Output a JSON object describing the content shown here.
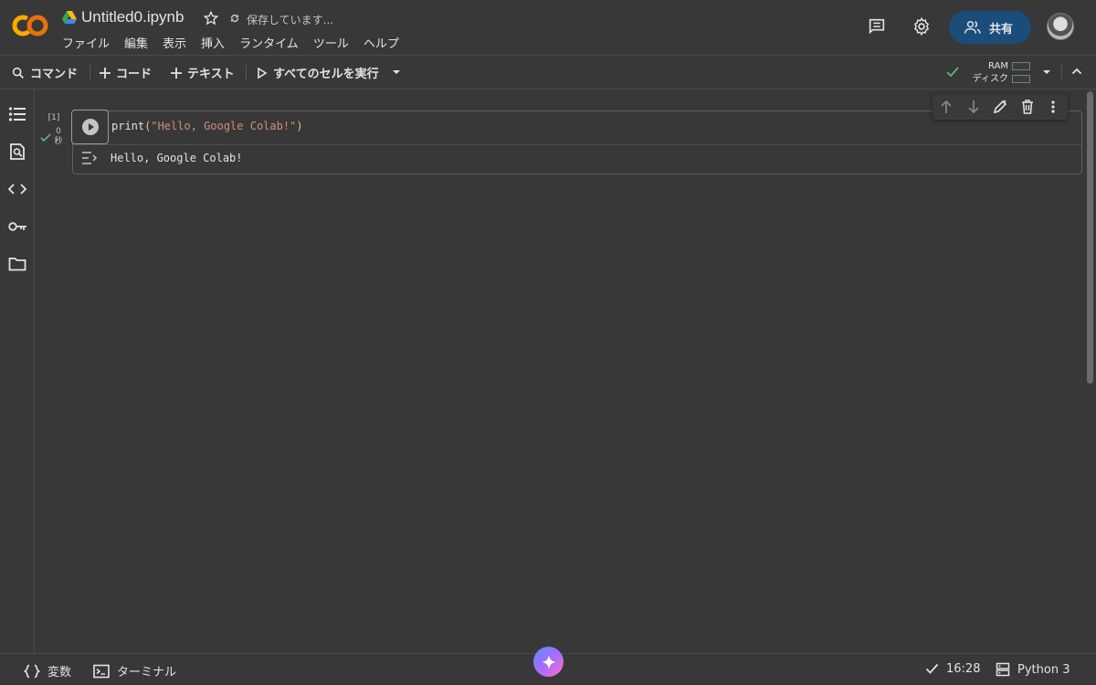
{
  "header": {
    "logo_text": "CO",
    "title": "Untitled0.ipynb",
    "saving_status": "保存しています...",
    "share_label": "共有",
    "menu": [
      "ファイル",
      "編集",
      "表示",
      "挿入",
      "ランタイム",
      "ツール",
      "ヘルプ"
    ]
  },
  "toolbar": {
    "command": "コマンド",
    "code": "コード",
    "text": "テキスト",
    "run_all": "すべてのセルを実行",
    "ram": "RAM",
    "disk": "ディスク"
  },
  "cell": {
    "exec_count": "[1]",
    "exec_time_value": "0",
    "exec_time_unit": "秒",
    "code_fn": "print",
    "code_open": "(",
    "code_str": "\"Hello, Google Colab!\"",
    "code_close": ")",
    "output": "Hello, Google Colab!"
  },
  "status": {
    "variables": "変数",
    "terminal": "ターミナル",
    "time": "16:28",
    "runtime": "Python 3"
  },
  "colors": {
    "accent_orange": "#f9ab00",
    "logo_orange": "#e8710a",
    "check_green": "#5bb974",
    "share_bg": "#1a4d7a"
  }
}
